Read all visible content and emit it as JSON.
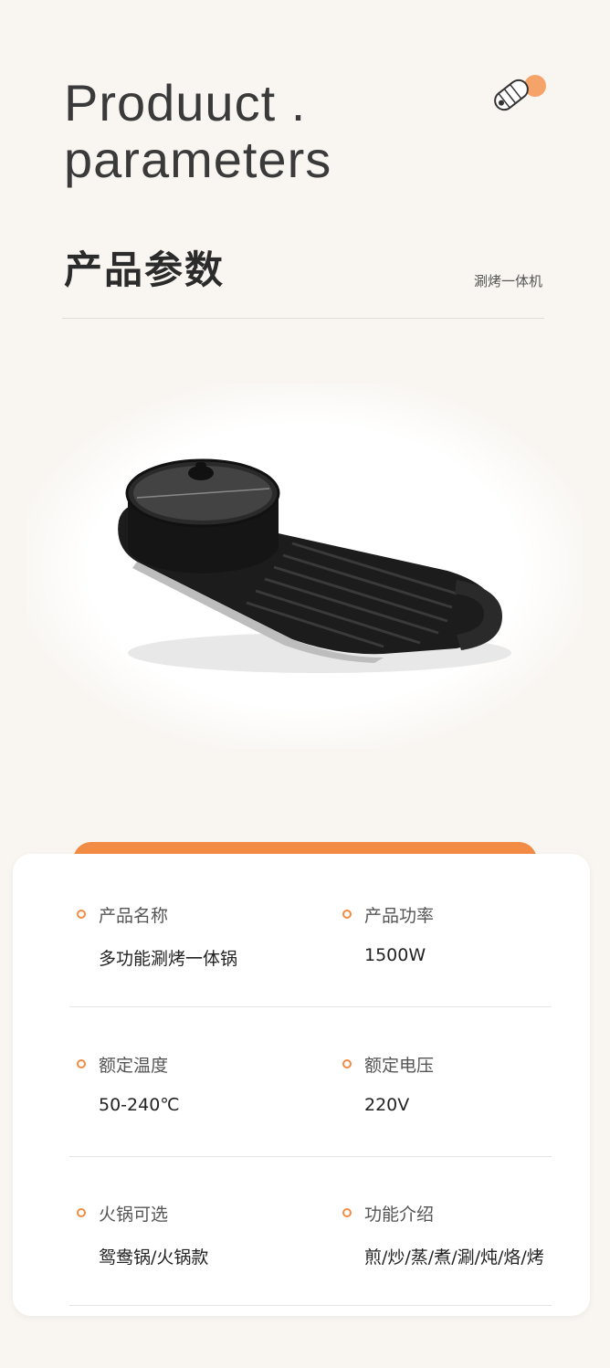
{
  "header": {
    "title_en_line1": "Produuct .",
    "title_en_line2": "parameters",
    "title_cn": "产品参数",
    "subtitle": "涮烤一体机"
  },
  "colors": {
    "accent": "#f28c45",
    "background": "#f9f6f2",
    "card": "#ffffff"
  },
  "icons": {
    "brand": "rolling-cylinder-icon",
    "bullet": "orange-ring-bullet-icon"
  },
  "product_image": "grill-hotpot-combo-photo",
  "params": [
    {
      "left": {
        "label": "产品名称",
        "value": "多功能涮烤一体锅"
      },
      "right": {
        "label": "产品功率",
        "value": "1500W"
      }
    },
    {
      "left": {
        "label": "额定温度",
        "value": "50-240℃"
      },
      "right": {
        "label": "额定电压",
        "value": "220V"
      }
    },
    {
      "left": {
        "label": "火锅可选",
        "value": "鸳鸯锅/火锅款"
      },
      "right": {
        "label": "功能介绍",
        "value": "煎/炒/蒸/煮/涮/炖/烙/烤"
      }
    }
  ]
}
